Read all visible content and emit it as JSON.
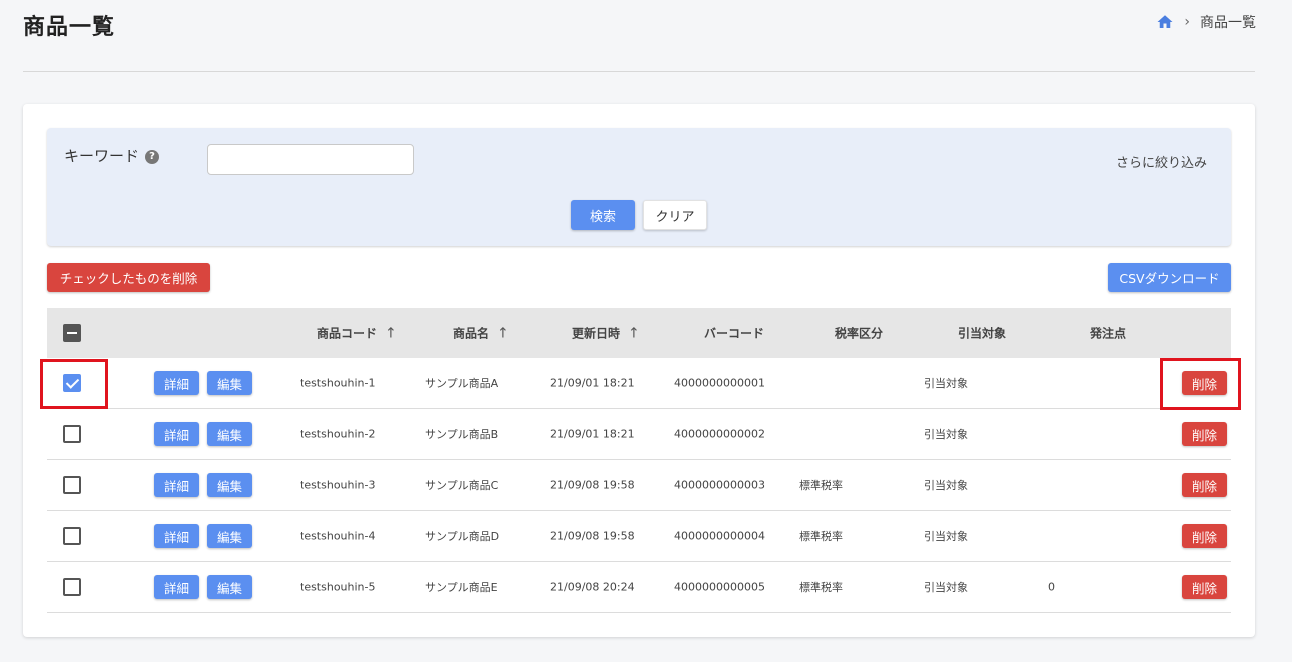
{
  "header": {
    "title": "商品一覧",
    "breadcrumb": {
      "current": "商品一覧"
    }
  },
  "filter": {
    "keyword_label": "キーワード",
    "keyword_value": "",
    "more_filter_label": "さらに絞り込み",
    "search_label": "検索",
    "clear_label": "クリア"
  },
  "actions": {
    "bulk_delete_label": "チェックしたものを削除",
    "csv_label": "CSVダウンロード"
  },
  "table": {
    "columns": {
      "code": "商品コード",
      "name": "商品名",
      "updated": "更新日時",
      "barcode": "バーコード",
      "tax": "税率区分",
      "allocation": "引当対象",
      "reorder": "発注点"
    },
    "detail_label": "詳細",
    "edit_label": "編集",
    "delete_label": "削除",
    "rows": [
      {
        "checked": true,
        "code": "testshouhin-1",
        "name": "サンプル商品A",
        "updated": "21/09/01 18:21",
        "barcode": "4000000000001",
        "tax": "",
        "allocation": "引当対象",
        "reorder": ""
      },
      {
        "checked": false,
        "code": "testshouhin-2",
        "name": "サンプル商品B",
        "updated": "21/09/01 18:21",
        "barcode": "4000000000002",
        "tax": "",
        "allocation": "引当対象",
        "reorder": ""
      },
      {
        "checked": false,
        "code": "testshouhin-3",
        "name": "サンプル商品C",
        "updated": "21/09/08 19:58",
        "barcode": "4000000000003",
        "tax": "標準税率",
        "allocation": "引当対象",
        "reorder": ""
      },
      {
        "checked": false,
        "code": "testshouhin-4",
        "name": "サンプル商品D",
        "updated": "21/09/08 19:58",
        "barcode": "4000000000004",
        "tax": "標準税率",
        "allocation": "引当対象",
        "reorder": ""
      },
      {
        "checked": false,
        "code": "testshouhin-5",
        "name": "サンプル商品E",
        "updated": "21/09/08 20:24",
        "barcode": "4000000000005",
        "tax": "標準税率",
        "allocation": "引当対象",
        "reorder": "0"
      }
    ]
  },
  "colors": {
    "primary": "#5b8ff0",
    "danger": "#d9453e",
    "highlight": "#e0141e",
    "filter_bg": "#e8eef9"
  }
}
